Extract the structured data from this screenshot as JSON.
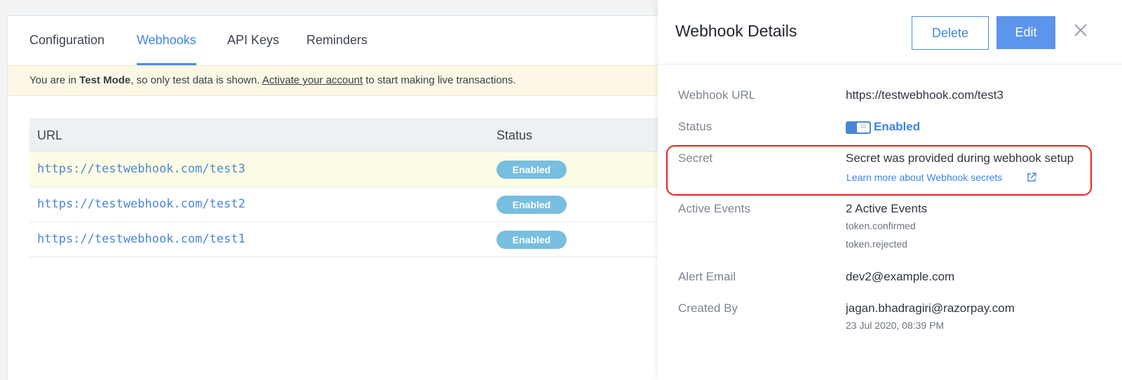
{
  "tabs": [
    {
      "label": "Configuration"
    },
    {
      "label": "Webhooks"
    },
    {
      "label": "API Keys"
    },
    {
      "label": "Reminders"
    }
  ],
  "banner": {
    "prefix": "You are in ",
    "mode": "Test Mode",
    "middle": ", so only test data is shown. ",
    "link": "Activate your account",
    "suffix": " to start making live transactions."
  },
  "table": {
    "headers": {
      "url": "URL",
      "status": "Status"
    },
    "rows": [
      {
        "url": "https://testwebhook.com/test3",
        "status": "Enabled"
      },
      {
        "url": "https://testwebhook.com/test2",
        "status": "Enabled"
      },
      {
        "url": "https://testwebhook.com/test1",
        "status": "Enabled"
      }
    ]
  },
  "panel": {
    "title": "Webhook Details",
    "delete_label": "Delete",
    "edit_label": "Edit",
    "close_icon": "close-icon",
    "fields": {
      "url_label": "Webhook URL",
      "url_value": "https://testwebhook.com/test3",
      "status_label": "Status",
      "status_value": "Enabled",
      "secret_label": "Secret",
      "secret_value": "Secret was provided during webhook setup",
      "secret_link": "Learn more about Webhook secrets",
      "events_label": "Active Events",
      "events_value": "2 Active Events",
      "events": [
        "token.confirmed",
        "token.rejected"
      ],
      "alert_label": "Alert Email",
      "alert_value": "dev2@example.com",
      "created_label": "Created By",
      "created_value": "jagan.bhadragiri@razorpay.com",
      "created_date": "23 Jul 2020, 08:39 PM"
    }
  },
  "colors": {
    "accent": "#3e84e6",
    "status_pill": "#78bedf",
    "banner_bg": "#fdf8e6",
    "highlight_border": "#e1251b"
  }
}
